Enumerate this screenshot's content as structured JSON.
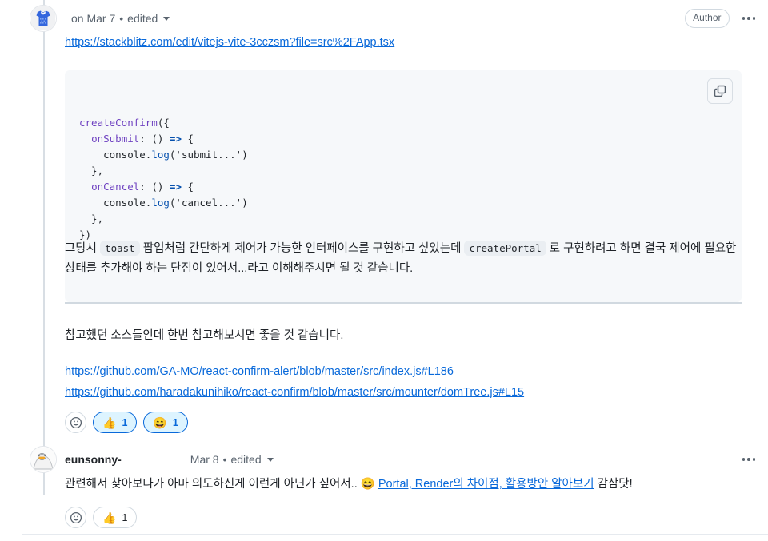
{
  "comments": [
    {
      "id": "comment-1",
      "avatar_icon": "tshirt-identicon-avatar",
      "author": "",
      "timestamp": "on Mar 7",
      "separator": "•",
      "edited_label": "edited",
      "author_badge": "Author",
      "link": "https://stackblitz.com/edit/vitejs-vite-3cczsm?file=src%2FApp.tsx",
      "code": {
        "copy_icon": "copy-icon",
        "lines": [
          [
            {
              "t": "createConfirm",
              "c": "fn"
            },
            {
              "t": "({",
              "c": "punc"
            }
          ],
          [
            {
              "t": "  ",
              "c": "punc"
            },
            {
              "t": "onSubmit",
              "c": "prop"
            },
            {
              "t": ": () ",
              "c": "punc"
            },
            {
              "t": "=>",
              "c": "kw"
            },
            {
              "t": " {",
              "c": "punc"
            }
          ],
          [
            {
              "t": "    console.",
              "c": "punc"
            },
            {
              "t": "log",
              "c": "meth"
            },
            {
              "t": "(",
              "c": "punc"
            },
            {
              "t": "'submit...'",
              "c": "str"
            },
            {
              "t": ")",
              "c": "punc"
            }
          ],
          [
            {
              "t": "  },",
              "c": "punc"
            }
          ],
          [
            {
              "t": "  ",
              "c": "punc"
            },
            {
              "t": "onCancel",
              "c": "prop"
            },
            {
              "t": ": () ",
              "c": "punc"
            },
            {
              "t": "=>",
              "c": "kw"
            },
            {
              "t": " {",
              "c": "punc"
            }
          ],
          [
            {
              "t": "    console.",
              "c": "punc"
            },
            {
              "t": "log",
              "c": "meth"
            },
            {
              "t": "(",
              "c": "punc"
            },
            {
              "t": "'cancel...'",
              "c": "str"
            },
            {
              "t": ")",
              "c": "punc"
            }
          ],
          [
            {
              "t": "  },",
              "c": "punc"
            }
          ],
          [
            {
              "t": "})",
              "c": "punc"
            }
          ]
        ]
      },
      "paragraph_1": [
        {
          "t": "그당시 ",
          "k": "text"
        },
        {
          "t": "toast",
          "k": "code"
        },
        {
          "t": " 팝업처럼 간단하게 제어가 가능한 인터페이스를 구현하고 싶었는데 ",
          "k": "text"
        },
        {
          "t": "createPortal",
          "k": "code"
        },
        {
          "t": " 로 구현하려고 하면 결국 제어에 필요한 상태를 추가해야 하는 단점이 있어서...라고 이해해주시면 될 것 같습니다.",
          "k": "text"
        }
      ],
      "paragraph_2": "참고했던 소스들인데 한번 참고해보시면 좋을 것 같습니다.",
      "source_links": [
        "https://github.com/GA-MO/react-confirm-alert/blob/master/src/index.js#L186",
        "https://github.com/haradakunihiko/react-confirm/blob/master/src/mounter/domTree.js#L15"
      ],
      "reactions": {
        "add_icon": "smiley-add-reaction-icon",
        "items": [
          {
            "emoji": "👍",
            "name": "thumbs-up",
            "count": "1",
            "active": true
          },
          {
            "emoji": "😄",
            "name": "grinning-face",
            "count": "1",
            "active": true
          }
        ]
      }
    },
    {
      "id": "comment-2",
      "avatar_icon": "photo-avatar",
      "author": "eunsonny-",
      "timestamp": "Mar 8",
      "separator": "•",
      "edited_label": "edited",
      "author_badge": "",
      "paragraph_1": [
        {
          "t": "관련해서 찾아보다가 아마 의도하신게 이런게 아닌가 싶어서.. ",
          "k": "text"
        },
        {
          "t": "😄",
          "k": "emoji"
        },
        {
          "t": " ",
          "k": "text"
        },
        {
          "t": "Portal, Render의 차이점, 활용방안 알아보기",
          "k": "link"
        },
        {
          "t": " 감삼닷!",
          "k": "text"
        }
      ],
      "reactions": {
        "add_icon": "smiley-add-reaction-icon",
        "items": [
          {
            "emoji": "👍",
            "name": "thumbs-up",
            "count": "1",
            "active": false
          }
        ]
      }
    }
  ],
  "colors": {
    "link": "#0969da",
    "text": "#1f2328",
    "muted": "#59636e",
    "code_bg": "#f6f8fa",
    "inline_code_bg": "#eaeef2",
    "border": "#d1d9e0",
    "reaction_active_bg": "#ddf4ff"
  }
}
